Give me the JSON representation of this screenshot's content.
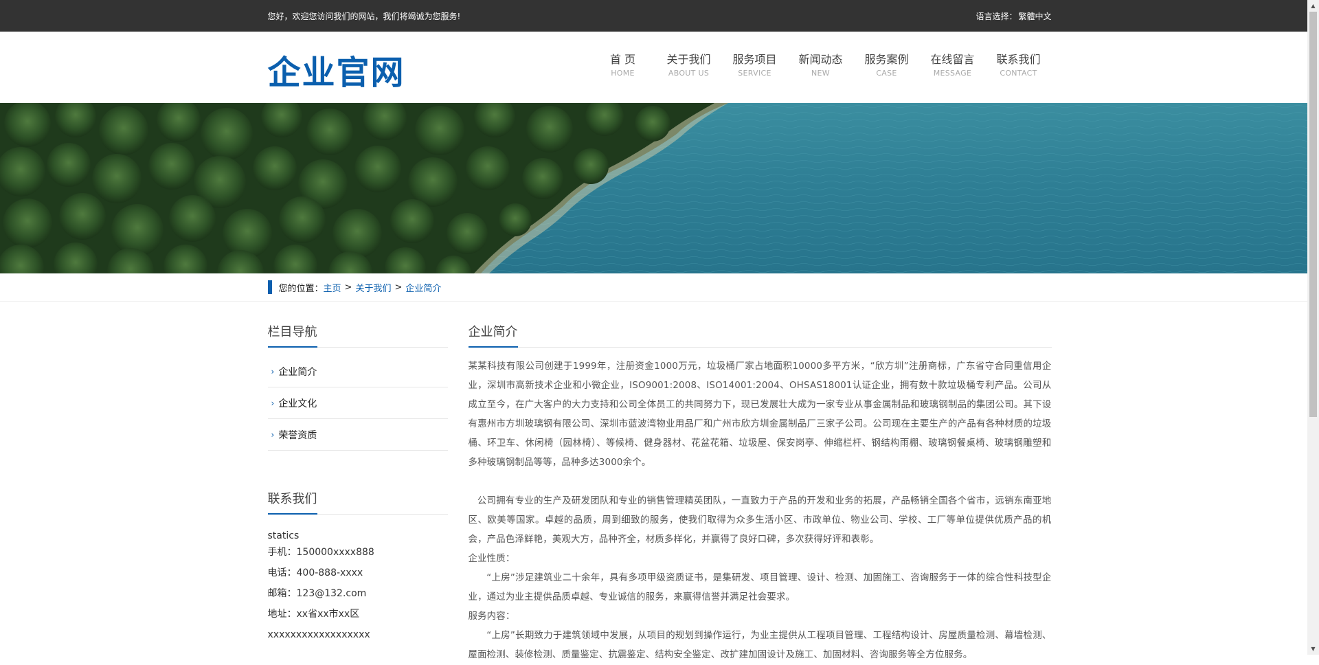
{
  "topbar": {
    "welcome": "您好，欢迎您访问我们的网站，我们将竭诚为您服务!",
    "lang_label": "语言选择：",
    "lang_option": "繁體中文"
  },
  "header": {
    "logo": "企业官网",
    "nav": [
      {
        "cn": "首 页",
        "en": "HOME"
      },
      {
        "cn": "关于我们",
        "en": "ABOUT US"
      },
      {
        "cn": "服务项目",
        "en": "SERVICE"
      },
      {
        "cn": "新闻动态",
        "en": "NEW"
      },
      {
        "cn": "服务案例",
        "en": "CASE"
      },
      {
        "cn": "在线留言",
        "en": "MESSAGE"
      },
      {
        "cn": "联系我们",
        "en": "CONTACT"
      }
    ]
  },
  "breadcrumb": {
    "label": "您的位置：",
    "items": [
      "主页",
      "关于我们",
      "企业简介"
    ],
    "sep": ">"
  },
  "sidebar": {
    "nav_title": "栏目导航",
    "items": [
      "企业简介",
      "企业文化",
      "荣誉资质"
    ],
    "contact_title": "联系我们",
    "contact": {
      "org": "statics",
      "phone": "手机：150000xxxx888",
      "tel": "电话：400-888-xxxx",
      "email": "邮箱：123@132.com",
      "address": "地址：xx省xx市xx区xxxxxxxxxxxxxxxxxx"
    }
  },
  "content": {
    "title": "企业简介",
    "paragraphs": [
      " 某某科技有限公司创建于1999年，注册资金1000万元，垃圾桶厂家占地面积10000多平方米，“欣方圳”注册商标，广东省守合同重信用企业，深圳市高新技术企业和小微企业，ISO9001:2008、ISO14001:2004、OHSAS18001认证企业，拥有数十款垃圾桶专利产品。公司从成立至今，在广大客户的大力支持和公司全体员工的共同努力下，现已发展壮大成为一家专业从事金属制品和玻璃钢制品的集团公司。其下设有惠州市方圳玻璃钢有限公司、深圳市蓝波湾物业用品厂和广州市欣方圳金属制品厂三家子公司。公司现在主要生产的产品有各种材质的垃圾桶、环卫车、休闲椅（园林椅）、等候椅、健身器材、花盆花箱、垃圾屋、保安岗亭、伸缩栏杆、钢结构雨棚、玻璃钢餐桌椅、玻璃钢雕塑和多种玻璃钢制品等等，品种多达3000余个。",
      "公司拥有专业的生产及研发团队和专业的销售管理精英团队，一直致力于产品的开发和业务的拓展，产品畅销全国各个省市，远销东南亚地区、欧美等国家。卓越的品质，周到细致的服务，使我们取得为众多生活小区、市政单位、物业公司、学校、工厂等单位提供优质产品的机会，产品色泽鲜艳，美观大方，品种齐全，材质多样化，并赢得了良好口碑，多次获得好评和表彰。",
      "企业性质：",
      "“上房”涉足建筑业二十余年，具有多项甲级资质证书，是集研发、项目管理、设计、检测、加固施工、咨询服务于一体的综合性科技型企业，通过为业主提供品质卓越、专业诚信的服务，来赢得信誉并满足社会要求。",
      "服务内容：",
      "“上房”长期致力于建筑领域中发展，从项目的规划到操作运行，为业主提供从工程项目管理、工程结构设计、房屋质量检测、幕墙检测、屋面检测、装修检测、质量鉴定、抗震鉴定、结构安全鉴定、改扩建加固设计及施工、加固材料、咨询服务等全方位服务。"
    ]
  },
  "scrollbar": {
    "position": 0.0
  }
}
